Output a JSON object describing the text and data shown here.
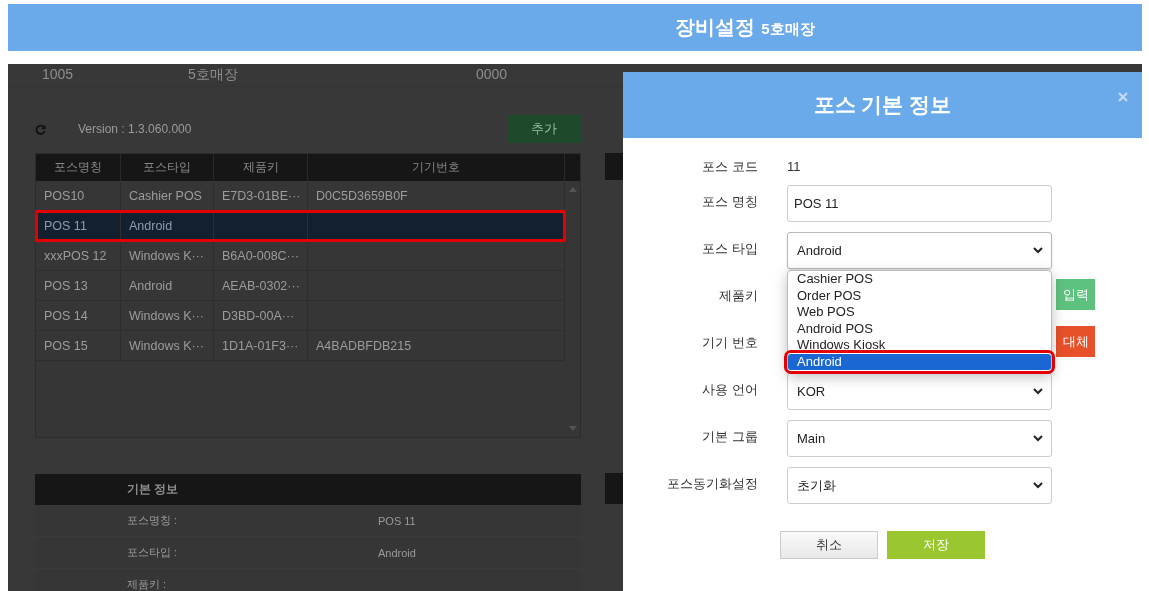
{
  "header": {
    "title": "장비설정",
    "subtitle": "5호매장"
  },
  "store_row": [
    "1005",
    "5호매장",
    "0000"
  ],
  "version": "Version : 1.3.060.000",
  "add_button": "추가",
  "table": {
    "columns": [
      "포스명칭",
      "포스타입",
      "제품키",
      "기기번호"
    ],
    "rows": [
      {
        "cells": [
          "POS10",
          "Cashier POS",
          "E7D3-01BE···",
          "D0C5D3659B0F"
        ],
        "selected": false
      },
      {
        "cells": [
          "POS 11",
          "Android",
          "",
          ""
        ],
        "selected": true
      },
      {
        "cells": [
          "xxxPOS 12",
          "Windows K···",
          "B6A0-008C···",
          ""
        ],
        "selected": false
      },
      {
        "cells": [
          "POS 13",
          "Android",
          "AEAB-0302···",
          ""
        ],
        "selected": false
      },
      {
        "cells": [
          "POS 14",
          "Windows K···",
          "D3BD-00A···",
          ""
        ],
        "selected": false
      },
      {
        "cells": [
          "POS 15",
          "Windows K···",
          "1D1A-01F3···",
          "A4BADBFDB215"
        ],
        "selected": false
      }
    ]
  },
  "info_panel": {
    "title": "기본 정보",
    "rows": [
      {
        "label": "포스명칭 :",
        "value": "POS 11"
      },
      {
        "label": "포스타입 :",
        "value": "Android"
      },
      {
        "label": "제품키 :"
      }
    ]
  },
  "modal": {
    "title": "포스 기본 정보",
    "fields": [
      {
        "kind": "text",
        "label": "포스 코드",
        "value": "11"
      },
      {
        "kind": "input",
        "label": "포스 명칭",
        "value": "POS 11"
      },
      {
        "kind": "select",
        "label": "포스 타입",
        "value": "Android",
        "open": true,
        "options": [
          {
            "label": "Cashier POS",
            "selected": false
          },
          {
            "label": "Order POS",
            "selected": false
          },
          {
            "label": "Web POS",
            "selected": false
          },
          {
            "label": "Android POS",
            "selected": false
          },
          {
            "label": "Windows Kiosk",
            "selected": false
          },
          {
            "label": "Android",
            "selected": true
          }
        ]
      },
      {
        "kind": "action",
        "label": "제품키",
        "button": {
          "label": "입력",
          "color": "#5ec27f"
        }
      },
      {
        "kind": "action",
        "label": "기기 번호",
        "button": {
          "label": "대체",
          "color": "#e8502a"
        }
      },
      {
        "kind": "select",
        "label": "사용 언어",
        "value": "KOR"
      },
      {
        "kind": "select",
        "label": "기본 그룹",
        "value": "Main"
      },
      {
        "kind": "select",
        "label": "포스동기화설정",
        "value": "초기화"
      }
    ],
    "buttons": [
      {
        "label": "취소",
        "kind": "secondary"
      },
      {
        "label": "저장",
        "kind": "primary"
      }
    ]
  }
}
